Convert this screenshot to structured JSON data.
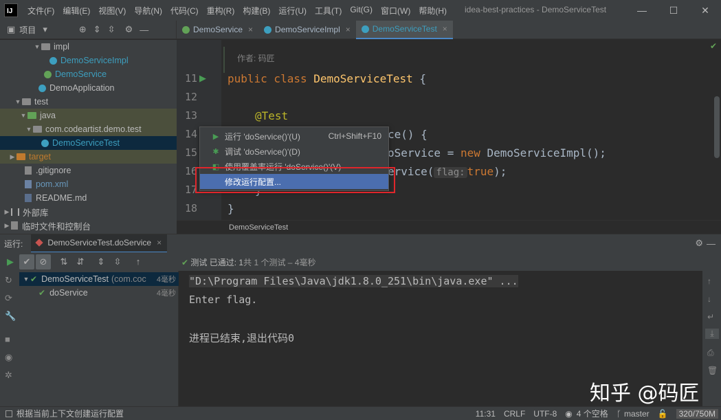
{
  "app": {
    "logo_text": "IJ",
    "menu": [
      "文件(F)",
      "编辑(E)",
      "视图(V)",
      "导航(N)",
      "代码(C)",
      "重构(R)",
      "构建(B)",
      "运行(U)",
      "工具(T)",
      "Git(G)",
      "窗口(W)",
      "帮助(H)"
    ],
    "title": "idea-best-practices - DemoServiceTest"
  },
  "window_controls": {
    "minimize": "—",
    "maximize": "☐",
    "close": "✕"
  },
  "project_panel": {
    "label": "项目",
    "tree": [
      {
        "label": "impl",
        "kind": "folder"
      },
      {
        "label": "DemoServiceImpl",
        "kind": "class"
      },
      {
        "label": "DemoService",
        "kind": "interface"
      },
      {
        "label": "DemoApplication",
        "kind": "app"
      },
      {
        "label": "test",
        "kind": "folder"
      },
      {
        "label": "java",
        "kind": "folder-test"
      },
      {
        "label": "com.codeartist.demo.test",
        "kind": "package"
      },
      {
        "label": "DemoServiceTest",
        "kind": "class"
      },
      {
        "label": "target",
        "kind": "folder-excluded"
      },
      {
        "label": ".gitignore",
        "kind": "file"
      },
      {
        "label": "pom.xml",
        "kind": "maven"
      },
      {
        "label": "README.md",
        "kind": "markdown"
      },
      {
        "label": "外部库",
        "kind": "library"
      },
      {
        "label": "临时文件和控制台",
        "kind": "scratch"
      }
    ]
  },
  "editor_tabs": [
    {
      "label": "DemoService"
    },
    {
      "label": "DemoServiceImpl"
    },
    {
      "label": "DemoServiceTest"
    }
  ],
  "editor": {
    "author_label": "作者: 码匠",
    "line_numbers": [
      "11",
      "12",
      "13",
      "14",
      "15",
      "16",
      "17",
      "18"
    ],
    "code": {
      "l11_kw": "public class ",
      "l11_cls": "DemoServiceTest",
      "l11_rest": " {",
      "l13_ann": "@Test",
      "l14": "ce() {",
      "l15_a": "oService = ",
      "l15_kw": "new",
      "l15_b": " DemoServiceImpl();",
      "l16_a": "ervice(",
      "l16_hint": "flag:",
      "l16_kw": "true",
      "l16_b": ");",
      "l17": "}",
      "l18": "}"
    },
    "breadcrumb": "DemoServiceTest"
  },
  "context_menu": {
    "items": [
      {
        "label": "运行 'doService()'(U)",
        "shortcut": "Ctrl+Shift+F10"
      },
      {
        "label": "调试 'doService()'(D)",
        "shortcut": ""
      },
      {
        "label": "使用覆盖率运行 'doService()'(V)",
        "shortcut": ""
      },
      {
        "label": "修改运行配置...",
        "shortcut": ""
      }
    ]
  },
  "run_panel": {
    "label": "运行:",
    "tab": "DemoServiceTest.doService",
    "status_prefix": "测试 已通过: ",
    "status_count": "1",
    "status_suffix": "共 1 个测试 – 4毫秒",
    "tests": [
      {
        "label": "DemoServiceTest",
        "extra": "(com.coc",
        "duration": "4毫秒"
      },
      {
        "label": "doService",
        "extra": "",
        "duration": "4毫秒"
      }
    ],
    "console": [
      "\"D:\\Program Files\\Java\\jdk1.8.0_251\\bin\\java.exe\" ...",
      "Enter flag.",
      "",
      "进程已结束,退出代码0"
    ]
  },
  "watermark": "知乎 @码匠",
  "status_bar": {
    "message": "根据当前上下文创建运行配置",
    "position": "11:31",
    "line_sep": "CRLF",
    "encoding": "UTF-8",
    "indent": "4 个空格",
    "branch": "master",
    "memory": "320/750M"
  }
}
